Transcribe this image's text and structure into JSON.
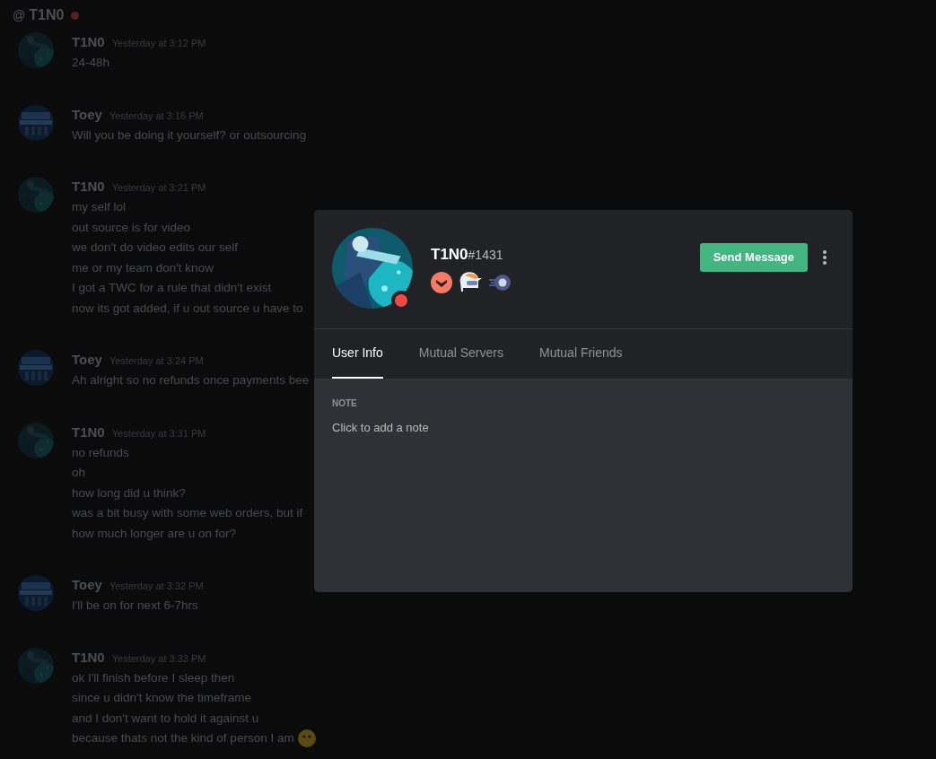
{
  "channel": {
    "prefix": "@",
    "name": "T1N0",
    "color": "#5a1c1c"
  },
  "messages": [
    {
      "author": "T1N0",
      "kind": "t1no",
      "time": "Yesterday at 3:12 PM",
      "lines": [
        "24-48h"
      ]
    },
    {
      "author": "Toey",
      "kind": "toey",
      "time": "Yesterday at 3:16 PM",
      "lines": [
        "Will you be doing it yourself? or outsourcing"
      ]
    },
    {
      "author": "T1N0",
      "kind": "t1no",
      "time": "Yesterday at 3:21 PM",
      "lines": [
        "my self lol",
        "out source is for video",
        "we don't do video edits our self",
        "me or my team don't know",
        "I got a TWC for a rule that didn't exist",
        "now its got added, if u out source u have to"
      ]
    },
    {
      "author": "Toey",
      "kind": "toey",
      "time": "Yesterday at 3:24 PM",
      "lines": [
        "Ah alright so no refunds once payments bee"
      ]
    },
    {
      "author": "T1N0",
      "kind": "t1no",
      "time": "Yesterday at 3:31 PM",
      "lines": [
        "no refunds",
        "oh",
        "how long did u think?",
        "was a bit busy with some web orders, but if",
        "how much longer are u on for?"
      ]
    },
    {
      "author": "Toey",
      "kind": "toey",
      "time": "Yesterday at 3:32 PM",
      "lines": [
        "I'll be on for next 6-7hrs"
      ]
    },
    {
      "author": "T1N0",
      "kind": "t1no",
      "time": "Yesterday at 3:33 PM",
      "lines": [
        "ok I'll finish before I sleep then",
        "since u didn't know the timeframe",
        "and I don't want to hold it against u",
        "because thats not the kind of person I am"
      ],
      "emoji_after_last": true
    }
  ],
  "profile": {
    "username": "T1N0",
    "discriminator": "#1431",
    "color": "#f04747",
    "badges": [
      {
        "kind": "chevron"
      },
      {
        "kind": "helmet"
      },
      {
        "kind": "ring"
      }
    ],
    "button": "Send Message",
    "tabs": [
      {
        "label": "User Info",
        "selected": true
      },
      {
        "label": "Mutual Servers",
        "selected": false
      },
      {
        "label": "Mutual Friends",
        "selected": false
      }
    ],
    "note": {
      "heading": "NOTE",
      "placeholder": "Click to add a note"
    }
  }
}
